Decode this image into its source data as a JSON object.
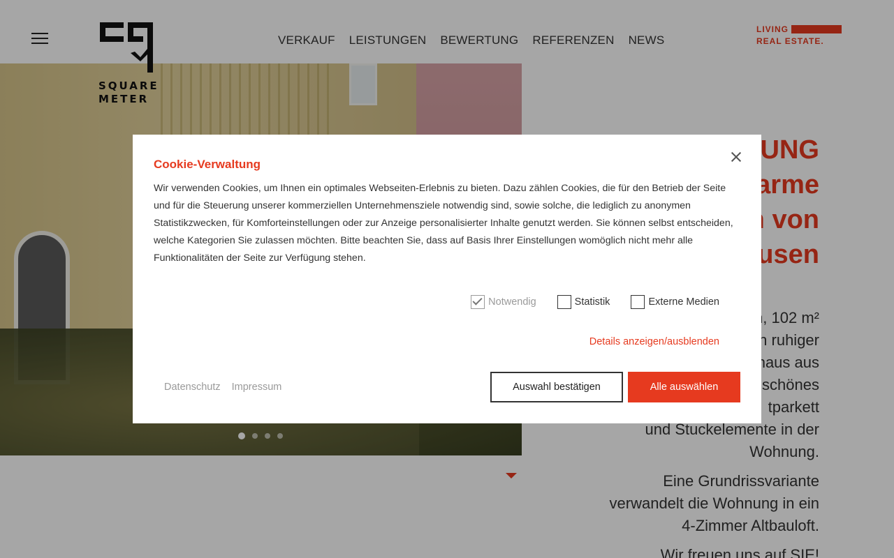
{
  "header": {
    "nav": [
      "VERKAUF",
      "LEISTUNGEN",
      "BEWERTUNG",
      "REFERENZEN",
      "NEWS"
    ],
    "logo_line1": "SQUARE",
    "logo_line2": "METER",
    "brand_line1": "LIVING",
    "brand_line2": "REAL ESTATE."
  },
  "hero": {
    "slide_count": 4,
    "active_slide": 1
  },
  "content": {
    "headline_lines": [
      "UNG",
      "arme",
      "n von",
      "usen"
    ],
    "desc_p1_lines": [
      "n, 102 m²",
      "n ruhiger",
      "haus aus",
      "schönes",
      "tparkett",
      "und Stuckelemente in der",
      "Wohnung."
    ],
    "desc_p2_lines": [
      "Eine Grundrissvariante",
      "verwandelt die Wohnung in ein",
      "4-Zimmer Altbauloft."
    ],
    "desc_p3": "Wir freuen uns auf SIE!"
  },
  "cookie": {
    "title": "Cookie-Verwaltung",
    "text": "Wir verwenden Cookies, um Ihnen ein optimales Webseiten-Erlebnis zu bieten. Dazu zählen Cookies, die für den Betrieb der Seite und für die Steuerung unserer kommerziellen Unternehmensziele notwendig sind, sowie solche, die lediglich zu anonymen Statistikzwecken, für Komforteinstellungen oder zur Anzeige personalisierter Inhalte genutzt werden. Sie können selbst entscheiden, welche Kategorien Sie zulassen möchten. Bitte beachten Sie, dass auf Basis Ihrer Einstellungen womöglich nicht mehr alle Funktionalitäten der Seite zur Verfügung stehen.",
    "options": [
      {
        "label": "Notwendig",
        "checked": true,
        "disabled": true
      },
      {
        "label": "Statistik",
        "checked": false,
        "disabled": false
      },
      {
        "label": "Externe Medien",
        "checked": false,
        "disabled": false
      }
    ],
    "details_link": "Details anzeigen/ausblenden",
    "footer_links": [
      "Datenschutz",
      "Impressum"
    ],
    "confirm_label": "Auswahl bestätigen",
    "accept_all_label": "Alle auswählen"
  },
  "colors": {
    "accent": "#e63a1f",
    "overlay": "rgba(0,0,0,0.35)"
  }
}
